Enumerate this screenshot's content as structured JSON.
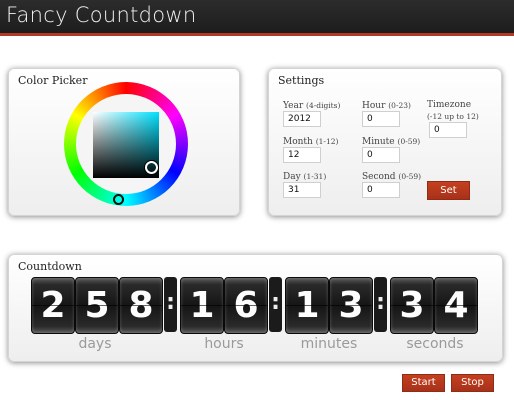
{
  "app": {
    "title": "Fancy Countdown"
  },
  "color_picker": {
    "title": "Color Picker",
    "selected_color": "#00e1ff"
  },
  "settings": {
    "title": "Settings",
    "year": {
      "label": "Year",
      "hint": "(4-digits)",
      "value": "2012"
    },
    "hour": {
      "label": "Hour",
      "hint": "(0-23)",
      "value": "0"
    },
    "timezone": {
      "label": "Timezone",
      "hint": "(-12 up to 12)",
      "value": "0"
    },
    "month": {
      "label": "Month",
      "hint": "(1-12)",
      "value": "12"
    },
    "minute": {
      "label": "Minute",
      "hint": "(0-59)",
      "value": "0"
    },
    "day": {
      "label": "Day",
      "hint": "(1-31)",
      "value": "31"
    },
    "second": {
      "label": "Second",
      "hint": "(0-59)",
      "value": "0"
    },
    "set_label": "Set"
  },
  "countdown": {
    "title": "Countdown",
    "digits": [
      "2",
      "5",
      "8",
      "1",
      "6",
      "1",
      "3",
      "3",
      "4"
    ],
    "separator": ":",
    "units": [
      "days",
      "hours",
      "minutes",
      "seconds"
    ]
  },
  "controls": {
    "start_label": "Start",
    "stop_label": "Stop"
  },
  "colors": {
    "accent": "#b33a22",
    "header_bg": "#1d1d1d"
  }
}
